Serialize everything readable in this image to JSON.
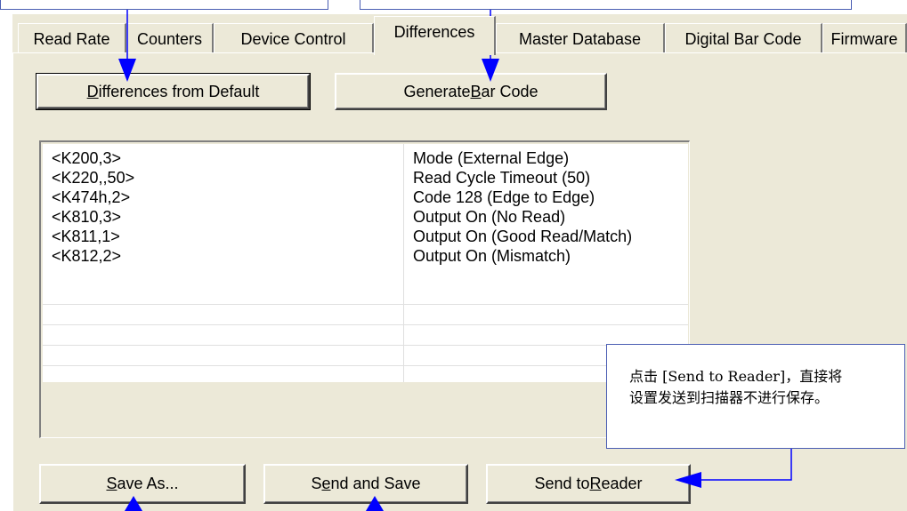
{
  "tabs": [
    "Read Rate",
    "Counters",
    "Device Control",
    "Differences",
    "Master Database",
    "Digital Bar Code",
    "Firmware"
  ],
  "active_tab": "Differences",
  "buttons": {
    "diff_pre": "",
    "diff_u": "D",
    "diff_post": "ifferences from Default",
    "gen_pre": "Generate ",
    "gen_u": "B",
    "gen_post": "ar Code",
    "saveas_pre": "",
    "saveas_u": "S",
    "saveas_post": "ave As...",
    "sendsave_pre": "S",
    "sendsave_u": "e",
    "sendsave_post": "nd and Save",
    "reader_pre": "Send to ",
    "reader_u": "R",
    "reader_post": "eader"
  },
  "differences": [
    {
      "code": "<K200,3>",
      "desc": "Mode (External Edge)"
    },
    {
      "code": "<K220,,50>",
      "desc": "Read Cycle Timeout (50)"
    },
    {
      "code": "<K474h,2>",
      "desc": "Code 128 (Edge to Edge)"
    },
    {
      "code": "<K810,3>",
      "desc": "Output On (No Read)"
    },
    {
      "code": "<K811,1>",
      "desc": "Output On (Good Read/Match)"
    },
    {
      "code": "<K812,2>",
      "desc": "Output On (Mismatch)"
    }
  ],
  "callout": {
    "line1": "点击 [Send to Reader]，直接将",
    "line2": "设置发送到扫描器不进行保存。"
  },
  "colors": {
    "arrow": "#0000ff",
    "callout_border": "#4a5db3"
  }
}
